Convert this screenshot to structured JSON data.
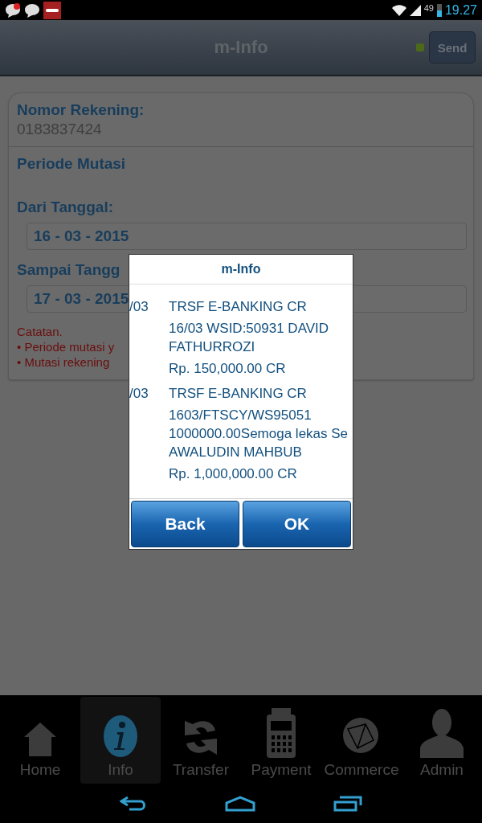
{
  "status_bar": {
    "battery": "49",
    "time": "19.27"
  },
  "header": {
    "title": "m-Info",
    "send_button": "Send",
    "online": true
  },
  "account": {
    "label": "Nomor Rekening:",
    "value": "0183837424"
  },
  "period": {
    "title": "Periode Mutasi",
    "from_label": "Dari Tanggal:",
    "from_value": "16 - 03 - 2015",
    "to_label": "Sampai Tangg",
    "to_value": "17 - 03 - 2015"
  },
  "notes": {
    "title": "Catatan.",
    "items": [
      "• Periode mutasi y",
      "• Mutasi rekening"
    ]
  },
  "dialog": {
    "title": "m-Info",
    "entries": [
      {
        "date": "/03",
        "lines": [
          "TRSF E-BANKING CR",
          "16/03 WSID:50931 DAVID FATHURROZI"
        ],
        "amount": "Rp. 150,000.00 CR"
      },
      {
        "date": "/03",
        "lines": [
          "TRSF E-BANKING CR",
          "1603/FTSCY/WS95051 1000000.00Semoga lekas Se AWALUDIN MAHBUB"
        ],
        "amount": "Rp. 1,000,000.00 CR"
      }
    ],
    "buttons": [
      "Back",
      "OK"
    ]
  },
  "nav": [
    {
      "label": "Home",
      "kind": "home",
      "selected": false
    },
    {
      "label": "Info",
      "kind": "info",
      "selected": true
    },
    {
      "label": "Transfer",
      "kind": "transfer",
      "selected": false
    },
    {
      "label": "Payment",
      "kind": "payment",
      "selected": false
    },
    {
      "label": "Commerce",
      "kind": "commerce",
      "selected": false
    },
    {
      "label": "Admin",
      "kind": "admin",
      "selected": false
    }
  ]
}
